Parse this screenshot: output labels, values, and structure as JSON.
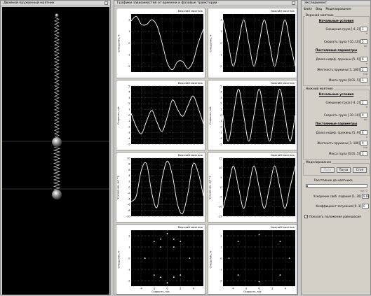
{
  "pendulum_window": {
    "title": "Двойной пружинный маятник"
  },
  "graphs_window": {
    "title": "Графики зависимостей от времени и фазовые траектории",
    "plots": [
      {
        "title": "Верхний маятник",
        "ylabel": "Смещение, м",
        "xlabel": "",
        "yticks": [
          "2",
          "1",
          "0",
          "-1",
          "-2"
        ],
        "xticks": []
      },
      {
        "title": "Нижний маятник",
        "ylabel": "Смещение, м",
        "xlabel": "",
        "yticks": [
          "2",
          "1",
          "0",
          "-1",
          "-2"
        ],
        "xticks": []
      },
      {
        "title": "Верхний маятник",
        "ylabel": "Скорость, м/с",
        "xlabel": "",
        "yticks": [
          "5",
          "4",
          "3",
          "2",
          "1",
          "0",
          "-1",
          "-2",
          "-3",
          "-4",
          "-5"
        ],
        "xticks": []
      },
      {
        "title": "Нижний маятник",
        "ylabel": "Скорость, м/с",
        "xlabel": "",
        "yticks": [
          "5",
          "4",
          "3",
          "2",
          "1",
          "0",
          "-1",
          "-2",
          "-3",
          "-4",
          "-5"
        ],
        "xticks": []
      },
      {
        "title": "Верхний маятник",
        "ylabel": "Ускорение, м/с^2",
        "xlabel": "",
        "yticks": [
          "10",
          "8",
          "6",
          "4",
          "2",
          "0",
          "-2",
          "-4",
          "-6",
          "-8",
          "-10"
        ],
        "xticks": []
      },
      {
        "title": "Нижний маятник",
        "ylabel": "Ускорение, м/с^2",
        "xlabel": "",
        "yticks": [
          "15",
          "10",
          "5",
          "0",
          "-5",
          "-10",
          "-15"
        ],
        "xticks": []
      },
      {
        "title": "Верхний маятник",
        "ylabel": "Смещение, м",
        "xlabel": "Скорость, м/с",
        "yticks": [
          "2",
          "1",
          "0",
          "-1",
          "-2"
        ],
        "xticks": [
          "-4",
          "-2",
          "0",
          "2",
          "4"
        ]
      },
      {
        "title": "Нижний маятник",
        "ylabel": "Смещение, м",
        "xlabel": "Скорость, м/с",
        "yticks": [
          "2",
          "1",
          "0",
          "-1",
          "-2"
        ],
        "xticks": [
          "-4",
          "-2",
          "0",
          "2",
          "4"
        ]
      }
    ]
  },
  "chart_data": [
    {
      "type": "line",
      "title": "Верхний маятник",
      "ylabel": "Смещение, м",
      "ylim": [
        -2.5,
        2.5
      ],
      "series": [
        {
          "x": [
            0,
            0.5,
            1,
            1.5,
            2,
            2.5,
            3,
            3.5,
            4,
            4.5,
            5,
            5.5,
            6,
            6.5,
            7
          ],
          "values": [
            1.9,
            2.3,
            1.6,
            1.6,
            2.0,
            1.5,
            0.0,
            -1.7,
            -2.3,
            -1.6,
            -1.6,
            -2.2,
            -1.6,
            0.0,
            1.2
          ]
        }
      ]
    },
    {
      "type": "line",
      "title": "Нижний маятник",
      "ylabel": "Смещение, м",
      "ylim": [
        -2.5,
        2.5
      ],
      "series": [
        {
          "x": [
            0,
            0.5,
            1,
            1.5,
            2,
            2.5,
            3,
            3.5,
            4,
            4.5,
            5,
            5.5,
            6,
            6.5,
            7
          ],
          "values": [
            2.0,
            0.0,
            -2.0,
            0.0,
            2.0,
            0.0,
            -2.0,
            0.0,
            2.0,
            0.0,
            -2.0,
            0.0,
            2.0,
            0.0,
            -2.0
          ]
        }
      ]
    },
    {
      "type": "line",
      "title": "Верхний маятник",
      "ylabel": "Скорость, м/с",
      "ylim": [
        -5,
        5
      ],
      "series": [
        {
          "x": [
            0,
            0.5,
            1,
            1.5,
            2,
            2.5,
            3,
            3.5,
            4,
            4.5,
            5,
            5.5,
            6,
            6.5,
            7
          ],
          "values": [
            0.3,
            -2.0,
            -3.2,
            -1.0,
            0.8,
            -1.2,
            -2.8,
            -0.3,
            2.6,
            1.0,
            -0.2,
            1.6,
            3.3,
            1.2,
            -1.5
          ]
        }
      ]
    },
    {
      "type": "line",
      "title": "Нижний маятник",
      "ylabel": "Скорость, м/с",
      "ylim": [
        -5,
        5
      ],
      "series": [
        {
          "x": [
            0,
            0.5,
            1,
            1.5,
            2,
            2.5,
            3,
            3.5,
            4,
            4.5,
            5,
            5.5,
            6,
            6.5,
            7
          ],
          "values": [
            0.0,
            -4.5,
            0.0,
            4.5,
            0.0,
            -4.5,
            0.0,
            4.5,
            0.0,
            -4.5,
            0.0,
            4.5,
            0.0,
            -4.5,
            0.0
          ]
        }
      ]
    },
    {
      "type": "line",
      "title": "Верхний маятник",
      "ylabel": "Ускорение, м/с^2",
      "ylim": [
        -10,
        10
      ],
      "series": [
        {
          "x": [
            0,
            0.5,
            1,
            1.5,
            2,
            2.5,
            3,
            3.5,
            4,
            4.5,
            5,
            5.5,
            6,
            6.5,
            7
          ],
          "values": [
            -5.0,
            -3.0,
            6.0,
            8.0,
            -2.0,
            -7.0,
            3.0,
            9.0,
            4.0,
            -6.0,
            -9.0,
            -2.0,
            8.0,
            5.0,
            -3.0
          ]
        }
      ]
    },
    {
      "type": "line",
      "title": "Нижний маятник",
      "ylabel": "Ускорение, м/с^2",
      "ylim": [
        -15,
        15
      ],
      "series": [
        {
          "x": [
            0,
            0.5,
            1,
            1.5,
            2,
            2.5,
            3,
            3.5,
            4,
            4.5,
            5,
            5.5,
            6,
            6.5,
            7
          ],
          "values": [
            -11.0,
            0.0,
            11.0,
            0.0,
            -11.0,
            0.0,
            11.0,
            0.0,
            -11.0,
            0.0,
            11.0,
            0.0,
            -11.0,
            0.0,
            11.0
          ]
        }
      ]
    },
    {
      "type": "scatter",
      "title": "Верхний маятник",
      "xlabel": "Скорость, м/с",
      "ylabel": "Смещение, м",
      "xlim": [
        -5.5,
        5.5
      ],
      "ylim": [
        -2.5,
        2.5
      ],
      "series": [
        {
          "x": [
            -3.4,
            -2.0,
            0.0,
            2.0,
            3.4,
            2.0,
            0.0,
            -2.0,
            -3.4,
            -1.0,
            1.0,
            -1.0,
            1.0,
            -1.0,
            1.0
          ],
          "values": [
            0.0,
            1.5,
            2.2,
            1.5,
            0.0,
            -1.5,
            -2.2,
            -1.5,
            0.0,
            1.7,
            1.7,
            1.0,
            1.0,
            -1.7,
            -1.7
          ]
        }
      ]
    },
    {
      "type": "scatter",
      "title": "Нижний маятник",
      "xlabel": "Скорость, м/с",
      "ylabel": "Смещение, м",
      "xlim": [
        -5.5,
        5.5
      ],
      "ylim": [
        -2.5,
        2.5
      ],
      "series": [
        {
          "x": [
            -4.6,
            -3.2,
            0.0,
            3.2,
            4.6,
            3.2,
            0.0,
            -3.2
          ],
          "values": [
            0.0,
            1.5,
            2.1,
            1.5,
            0.0,
            -1.5,
            -2.1,
            -1.5
          ]
        }
      ]
    }
  ],
  "experiment_window": {
    "title": "Эксперимент",
    "menu": [
      "Файл",
      "Вид",
      "Моделирование"
    ],
    "upper_group": "Верхний маятник",
    "lower_group": "Нижний маятник",
    "initial_conditions": "Начальные условия",
    "constant_params": "Постоянные параметры",
    "upper": {
      "displacement": {
        "label": "Смещение груза [-4..2]",
        "value": "1"
      },
      "speed": {
        "label": "Скорость груза [-10..10]",
        "value": "5"
      },
      "length": {
        "label": "Длина недеф. пружины [5..9]",
        "value": "6"
      },
      "stiffness": {
        "label": "Жесткость пружины [1..180]",
        "value": "2"
      },
      "mass": {
        "label": "Масса груза [0.01..5]",
        "value": "1"
      }
    },
    "lower": {
      "displacement": {
        "label": "Смещение груза [-4..2]",
        "value": "2"
      },
      "speed": {
        "label": "Скорость груза [-10..10]",
        "value": "0"
      },
      "length": {
        "label": "Длина недеф. пружины [5..9]",
        "value": "6"
      },
      "stiffness": {
        "label": "Жесткость пружины [1..180]",
        "value": "9"
      },
      "mass": {
        "label": "Масса груза [0.01..5]",
        "value": "1"
      }
    },
    "units": {
      "displacement": "м",
      "speed": "м/с",
      "length": "м",
      "stiffness": "Н/м",
      "mass": "кг"
    },
    "modeling_group": "Моделирование",
    "buttons": {
      "start": "Пуск",
      "pause": "Пауза",
      "stop": "Стоп"
    },
    "distance_label": "Расстояние до маятника",
    "gravity": {
      "label": "Ускорение своб. падения [1..20]",
      "value": "9.81",
      "unit": "м/с^2"
    },
    "damping": {
      "label": "Коэффициент затухания [0..1]",
      "value": "0"
    },
    "show_equilibrium": "Показать положения равновесия"
  }
}
